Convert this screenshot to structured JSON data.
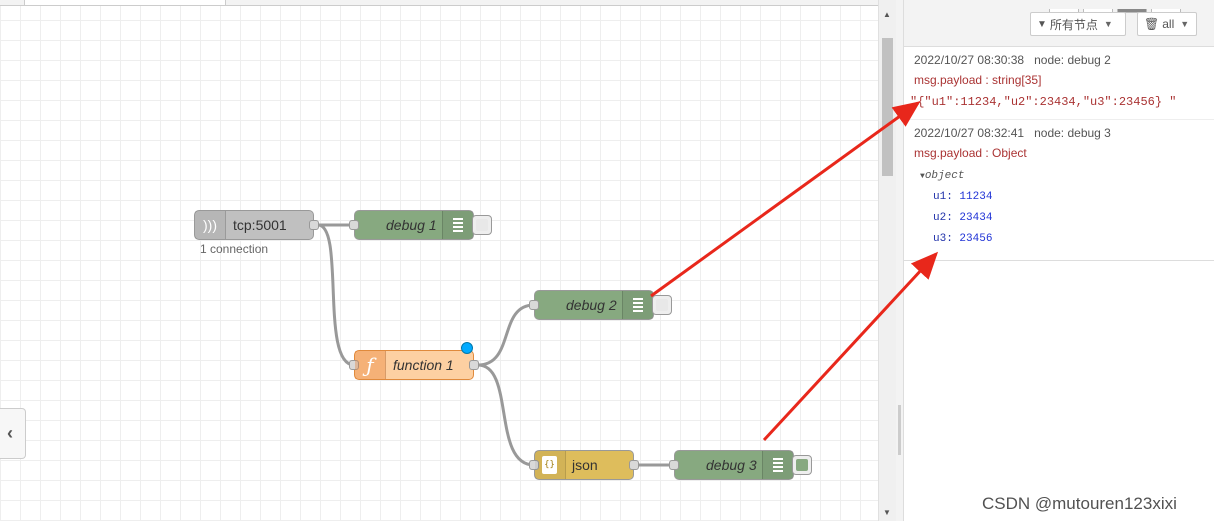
{
  "workspace": {
    "nodes": {
      "tcp": {
        "label": "tcp:5001",
        "status": "1 connection"
      },
      "debug1": {
        "label": "debug 1"
      },
      "debug2": {
        "label": "debug 2"
      },
      "function1": {
        "label": "function 1",
        "glyph": "ƒ"
      },
      "json": {
        "label": "json",
        "glyph": "{}"
      },
      "debug3": {
        "label": "debug 3"
      }
    },
    "colors": {
      "inject_gray": "#c0c0c0",
      "debug_green": "#87a980",
      "function_orange": "#fdd0a2",
      "json_yellow": "#debd5c",
      "changed_dot": "#00aaff",
      "annotation_red": "#e8271b"
    }
  },
  "debug_panel": {
    "filter_label": "所有节点",
    "clear_label": "all",
    "messages": [
      {
        "timestamp": "2022/10/27 08:30:38",
        "node": "node: debug 2",
        "payload_type": "msg.payload : string[35]",
        "value": "\"{\"u1\":11234,\"u2\":23434,\"u3\":23456} \""
      },
      {
        "timestamp": "2022/10/27 08:32:41",
        "node": "node: debug 3",
        "payload_type": "msg.payload : Object",
        "object_label": "object",
        "props": [
          {
            "key": "u1:",
            "value": "11234"
          },
          {
            "key": "u2:",
            "value": "23434"
          },
          {
            "key": "u3:",
            "value": "23456"
          }
        ]
      }
    ]
  },
  "watermark": "CSDN @mutouren123xixi",
  "icons": [
    "tcp-in-icon",
    "list-icon",
    "function-icon",
    "json-icon",
    "filter-icon",
    "trash-icon",
    "chevron-left-icon",
    "caret-down-icon",
    "triangle-down-icon"
  ]
}
